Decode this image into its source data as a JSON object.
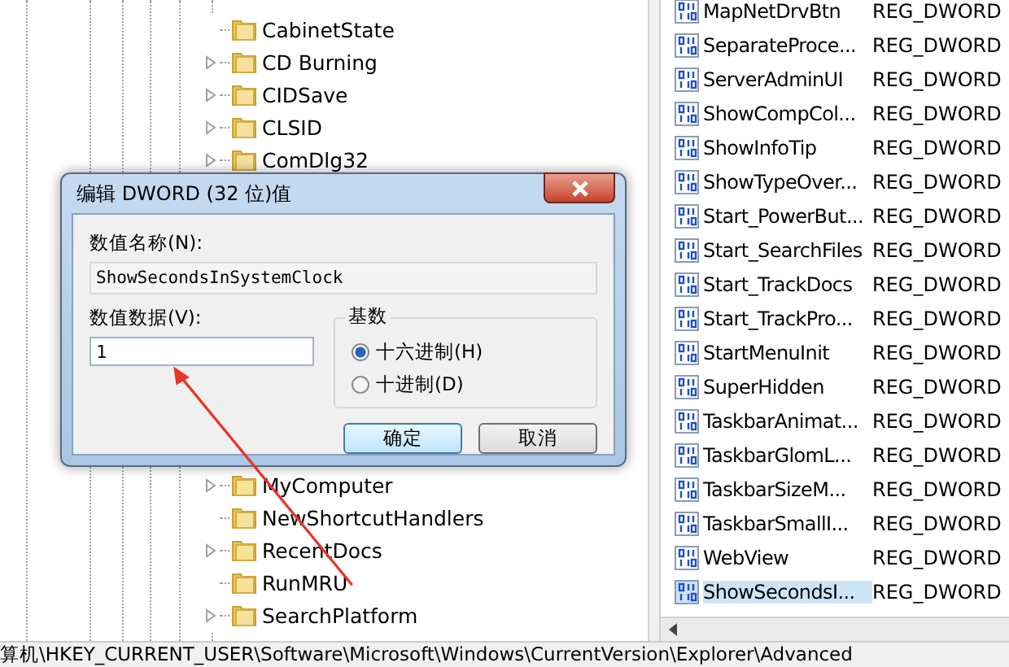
{
  "tree": {
    "items_above": [
      {
        "label": "CabinetState",
        "has_children": false
      },
      {
        "label": "CD Burning",
        "has_children": true
      },
      {
        "label": "CIDSave",
        "has_children": true
      },
      {
        "label": "CLSID",
        "has_children": true
      },
      {
        "label": "ComDlg32",
        "has_children": true
      }
    ],
    "items_below": [
      {
        "label": "MyComputer",
        "has_children": true
      },
      {
        "label": "NewShortcutHandlers",
        "has_children": false
      },
      {
        "label": "RecentDocs",
        "has_children": true
      },
      {
        "label": "RunMRU",
        "has_children": false
      },
      {
        "label": "SearchPlatform",
        "has_children": true
      }
    ]
  },
  "values": [
    {
      "name": "MapNetDrvBtn",
      "type": "REG_DWORD",
      "selected": false
    },
    {
      "name": "SeparateProce...",
      "type": "REG_DWORD",
      "selected": false
    },
    {
      "name": "ServerAdminUI",
      "type": "REG_DWORD",
      "selected": false
    },
    {
      "name": "ShowCompCol...",
      "type": "REG_DWORD",
      "selected": false
    },
    {
      "name": "ShowInfoTip",
      "type": "REG_DWORD",
      "selected": false
    },
    {
      "name": "ShowTypeOver...",
      "type": "REG_DWORD",
      "selected": false
    },
    {
      "name": "Start_PowerBut...",
      "type": "REG_DWORD",
      "selected": false
    },
    {
      "name": "Start_SearchFiles",
      "type": "REG_DWORD",
      "selected": false
    },
    {
      "name": "Start_TrackDocs",
      "type": "REG_DWORD",
      "selected": false
    },
    {
      "name": "Start_TrackPro...",
      "type": "REG_DWORD",
      "selected": false
    },
    {
      "name": "StartMenuInit",
      "type": "REG_DWORD",
      "selected": false
    },
    {
      "name": "SuperHidden",
      "type": "REG_DWORD",
      "selected": false
    },
    {
      "name": "TaskbarAnimat...",
      "type": "REG_DWORD",
      "selected": false
    },
    {
      "name": "TaskbarGlomL...",
      "type": "REG_DWORD",
      "selected": false
    },
    {
      "name": "TaskbarSizeM...",
      "type": "REG_DWORD",
      "selected": false
    },
    {
      "name": "TaskbarSmallI...",
      "type": "REG_DWORD",
      "selected": false
    },
    {
      "name": "WebView",
      "type": "REG_DWORD",
      "selected": false
    },
    {
      "name": "ShowSecondsI...",
      "type": "REG_DWORD",
      "selected": true
    }
  ],
  "status_bar": "算机\\HKEY_CURRENT_USER\\Software\\Microsoft\\Windows\\CurrentVersion\\Explorer\\Advanced",
  "dialog": {
    "title": "编辑 DWORD (32 位)值",
    "name_label": "数值名称(N):",
    "name_value": "ShowSecondsInSystemClock",
    "data_label": "数值数据(V):",
    "data_value": "1",
    "base_label": "基数",
    "bases": [
      {
        "label": "十六进制(H)",
        "selected": true
      },
      {
        "label": "十进制(D)",
        "selected": false
      }
    ],
    "buttons": [
      {
        "label": "确定",
        "kind": "default"
      },
      {
        "label": "取消",
        "kind": "normal"
      }
    ]
  }
}
